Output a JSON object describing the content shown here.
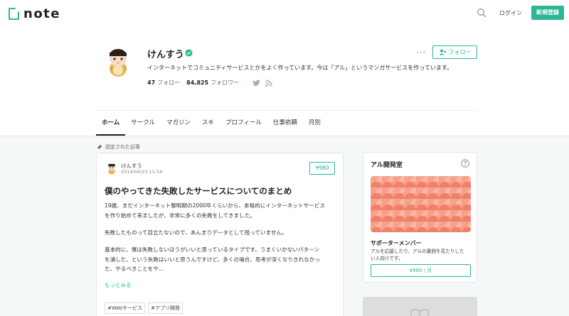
{
  "header": {
    "logo_text": "note",
    "login_label": "ログイン",
    "signup_label": "新規登録"
  },
  "profile": {
    "name": "けんすう",
    "bio": "インターネットでコミュニティサービスとかをよく作っています。今は「アル」というマンガサービスを作っています。",
    "following_count": "47",
    "following_label": "フォロー",
    "followers_count": "84,825",
    "followers_label": "フォロワー",
    "separator": "·",
    "more_label": "···",
    "follow_label": "フォロー"
  },
  "tabs": [
    "ホーム",
    "サークル",
    "マガジン",
    "スキ",
    "プロフィール",
    "仕事依頼",
    "月別"
  ],
  "pinned": {
    "label": "固定された記事"
  },
  "article": {
    "author": "けんすう",
    "date": "2019/04/23 11:54",
    "price": "¥980",
    "title": "僕のやってきた失敗したサービスについてのまとめ",
    "lines": [
      "19歳、まだインターネット黎明期の2000年くらいから、本格的にインターネットサービス",
      "を作り始めて来ましたが、非常に多くの失敗をしてきました。",
      "失敗したものって目立たないので、あんまりデータとして残っていません。",
      "基本的に、僕は失敗しないほうがいいと思っているタイプです。うまくいかないパターン",
      "を潰した、という失敗はいいと思うんですけど、多くの場合、思考が深くなりきれなかっ",
      "た、やるべきことをや..."
    ],
    "readmore": "もっとみる",
    "tags": [
      "#Webサービス",
      "#アプリ開発"
    ]
  },
  "sidebar": {
    "title": "アル開発室",
    "help_icon": "question-icon",
    "member_title": "サポーターメンバー",
    "member_desc": [
      "アルを応援したり、アルの裏側を見たりした",
      "い人向けです。"
    ],
    "member_price": "¥980 / 月"
  },
  "colors": {
    "accent": "#2cb696",
    "pattern_base": "#f7a08c",
    "pattern_dark": "#f0806a"
  }
}
